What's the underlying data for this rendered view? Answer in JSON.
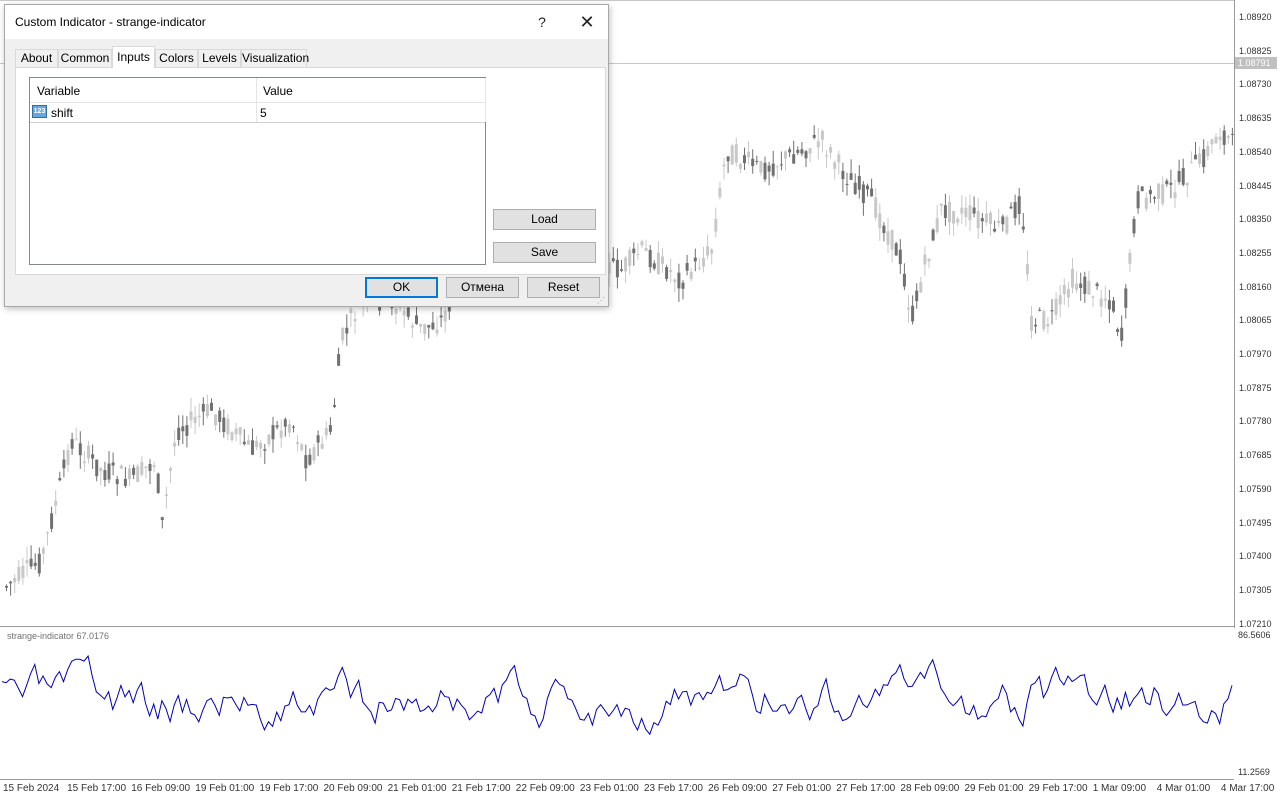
{
  "chart": {
    "price_axis": [
      "1.08920",
      "1.08825",
      "1.08730",
      "1.08635",
      "1.08540",
      "1.08445",
      "1.08350",
      "1.08255",
      "1.08160",
      "1.08065",
      "1.07970",
      "1.07875",
      "1.07780",
      "1.07685",
      "1.07590",
      "1.07495",
      "1.07400",
      "1.07305",
      "1.07210"
    ],
    "current_price": "1.08791",
    "time_axis": [
      "15 Feb 2024",
      "15 Feb 17:00",
      "16 Feb 09:00",
      "19 Feb 01:00",
      "19 Feb 17:00",
      "20 Feb 09:00",
      "21 Feb 01:00",
      "21 Feb 17:00",
      "22 Feb 09:00",
      "23 Feb 01:00",
      "23 Feb 17:00",
      "26 Feb 09:00",
      "27 Feb 01:00",
      "27 Feb 17:00",
      "28 Feb 09:00",
      "29 Feb 01:00",
      "29 Feb 17:00",
      "1 Mar 09:00",
      "4 Mar 01:00",
      "4 Mar 17:00"
    ],
    "candle_color_up": "#c8c8c8",
    "candle_color_down": "#707070",
    "indicator_color": "#0000b4"
  },
  "indicator": {
    "label": "strange-indicator 67.0176",
    "scale_max": "86.5606",
    "scale_min": "11.2569"
  },
  "dialog": {
    "title": "Custom Indicator - strange-indicator",
    "help_label": "?",
    "close_label": "✕",
    "tabs": [
      {
        "label": "About"
      },
      {
        "label": "Common"
      },
      {
        "label": "Inputs"
      },
      {
        "label": "Colors"
      },
      {
        "label": "Levels"
      },
      {
        "label": "Visualization"
      }
    ],
    "active_tab": "Inputs",
    "grid": {
      "col_variable": "Variable",
      "col_value": "Value",
      "rows": [
        {
          "icon": "123",
          "name": "shift",
          "value": "5"
        }
      ]
    },
    "buttons": {
      "load": "Load",
      "save": "Save",
      "ok": "OK",
      "cancel": "Отмена",
      "reset": "Reset"
    }
  }
}
